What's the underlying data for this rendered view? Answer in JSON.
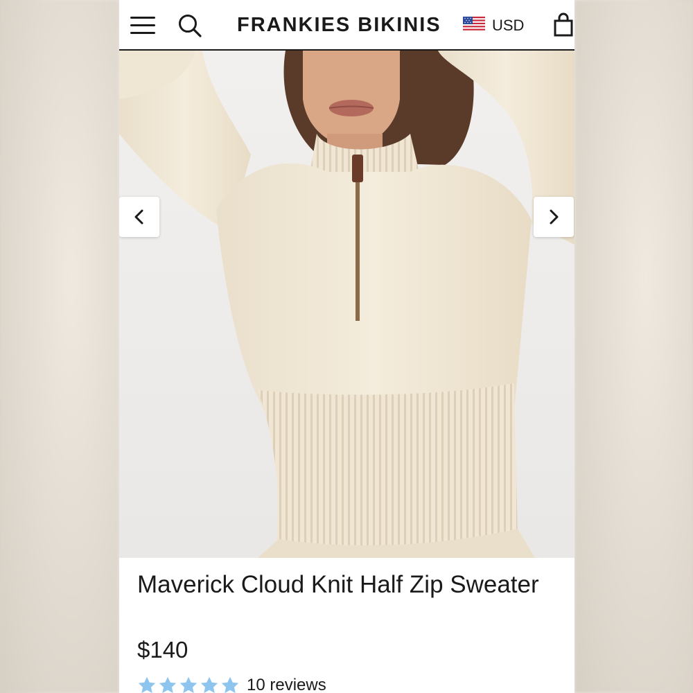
{
  "header": {
    "menu_icon": "hamburger-menu-icon",
    "search_icon": "search-icon",
    "brand": "FRANKIES BIKINIS",
    "flag_icon": "us-flag-icon",
    "currency": "USD",
    "cart_icon": "shopping-bag-icon"
  },
  "gallery": {
    "prev_icon": "chevron-left-icon",
    "next_icon": "chevron-right-icon",
    "image_subject": "model wearing cream ribbed half-zip sweater"
  },
  "product": {
    "title": "Maverick Cloud Knit Half Zip Sweater",
    "price": "$140",
    "rating": 5,
    "rating_max": 5,
    "reviews": "10 reviews"
  },
  "colors": {
    "text": "#1a1a1a",
    "star": "#8ec5ef",
    "sweater": "#f3ead8"
  }
}
